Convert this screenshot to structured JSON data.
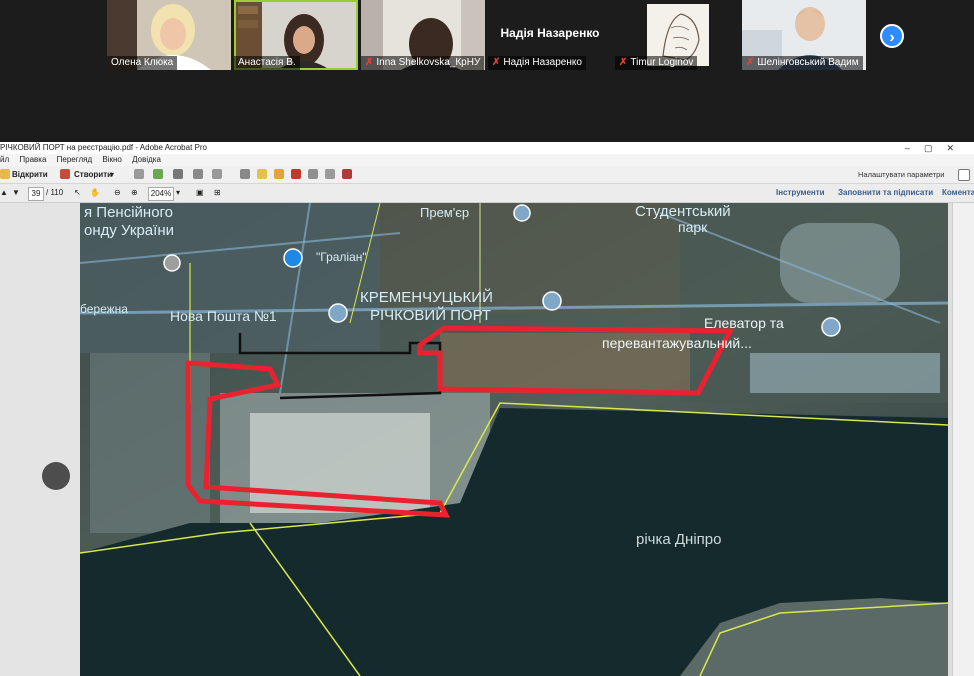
{
  "participants": [
    {
      "name": "Олена Клюка",
      "muted": false,
      "active": false,
      "has_video": true
    },
    {
      "name": "Анастасія В.",
      "muted": false,
      "active": true,
      "has_video": true
    },
    {
      "name": "Inna Shelkovska_КрНУ",
      "muted": true,
      "active": false,
      "has_video": true
    },
    {
      "name": "Надія Назаренко",
      "muted": true,
      "active": false,
      "has_video": false,
      "display_label": "Надія Назаренко"
    },
    {
      "name": "Timur Loginov",
      "muted": true,
      "active": false,
      "has_video": true
    },
    {
      "name": "Шелінговський Вадим",
      "muted": true,
      "active": false,
      "has_video": true
    }
  ],
  "next_button_icon": "chevron-right-icon",
  "acrobat": {
    "window_title": "РІЧКОВИЙ ПОРТ  на реєстрацію.pdf - Adobe Acrobat Pro",
    "menu": [
      "йл",
      "Правка",
      "Перегляд",
      "Вікно",
      "Довідка"
    ],
    "open_label": "Відкрити",
    "create_label": "Створити",
    "settings_label": "Налаштувати параметри",
    "page_current": "39",
    "page_total": "/ 110",
    "zoom": "204%",
    "tools_label": "Інструменти",
    "fill_sign_label": "Заповнити та підписати",
    "comment_label": "Комента"
  },
  "map": {
    "labels": {
      "pension_fund_1": "я Пенсійного",
      "pension_fund_2": "онду України",
      "gralian": "\"Граліан\"",
      "prem": "Прем'єр",
      "student_park_1": "Студентський",
      "student_park_2": "парк",
      "nova_poshta": "Нова Пошта №1",
      "naberezhna": "бережна",
      "port_1": "КРЕМЕНЧУЦЬКИЙ",
      "port_2": "РІЧКОВИЙ ПОРТ",
      "elevator_1": "Елеватор та",
      "elevator_2": "перевантажувальний...",
      "river": "річка Дніпро"
    },
    "colors": {
      "highlight": "#e8232f",
      "border_line": "#d8e84a",
      "water": "#142a2c"
    }
  }
}
